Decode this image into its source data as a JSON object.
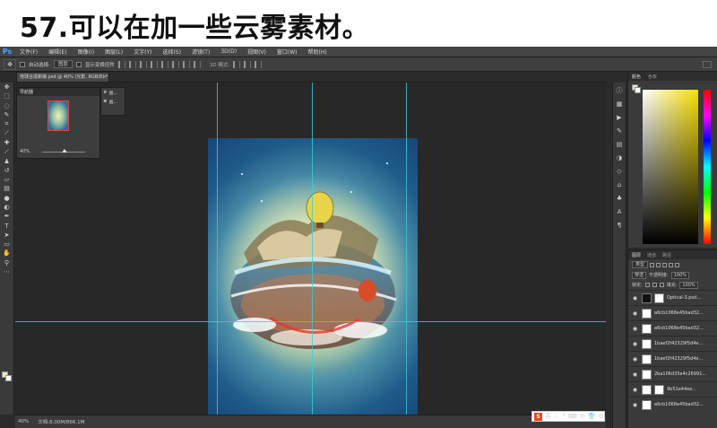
{
  "banner": {
    "title": "57.可以在加一些云雾素材。"
  },
  "app": {
    "logo": "Ps",
    "menu": [
      "文件(F)",
      "编辑(E)",
      "图像(I)",
      "图层(L)",
      "文字(Y)",
      "选择(S)",
      "滤镜(T)",
      "3D(D)",
      "视图(V)",
      "窗口(W)",
      "帮助(H)"
    ]
  },
  "options": {
    "auto_select_label": "自动选择:",
    "auto_select_value": "图层",
    "show_transform_label": "显示变换控件",
    "mode_3d_label": "3D 模式:"
  },
  "document": {
    "tab_title": "地球合成新娘.psd @ 40% (光影, RGB/8) *",
    "close_glyph": "×"
  },
  "navigator": {
    "title": "导航器",
    "zoom": "40%"
  },
  "mini_panel": {
    "item1": "画...",
    "item2": "画..."
  },
  "status": {
    "zoom": "40%",
    "doc_info": "文档:8.00M/866.1M"
  },
  "ime": {
    "logo": "S",
    "glyphs": [
      "英",
      "☾",
      "°",
      "⌨",
      "✉",
      "👕",
      "⚙"
    ]
  },
  "color_panel": {
    "tabs": [
      "颜色",
      "色板"
    ],
    "fg_color": "#f3e9b8",
    "bg_color": "#ffffff",
    "hue_top": "#ff0000"
  },
  "layers_panel": {
    "tabs": [
      "图层",
      "通道",
      "路径"
    ],
    "filter_kind": "类型",
    "blend_mode": "穿透",
    "opacity_label": "不透明度:",
    "opacity_value": "100%",
    "lock_label": "锁定:",
    "fill_label": "填充:",
    "fill_value": "100%",
    "layers": [
      {
        "name": "Optical-3.psd...",
        "thumb": "dark"
      },
      {
        "name": "a6cb1068e45bad32...",
        "thumb": "light"
      },
      {
        "name": "a6cb1068e45bad32...",
        "thumb": "light"
      },
      {
        "name": "1baef2f42329f5d4e...",
        "thumb": "light"
      },
      {
        "name": "1baef2f42329f5d4e...",
        "thumb": "light"
      },
      {
        "name": "2ba106d35e4c26991...",
        "thumb": "light"
      },
      {
        "name": "9b51e44ee...",
        "thumb": "light"
      },
      {
        "name": "a6cb1068e45bad32...",
        "thumb": "light"
      }
    ]
  }
}
